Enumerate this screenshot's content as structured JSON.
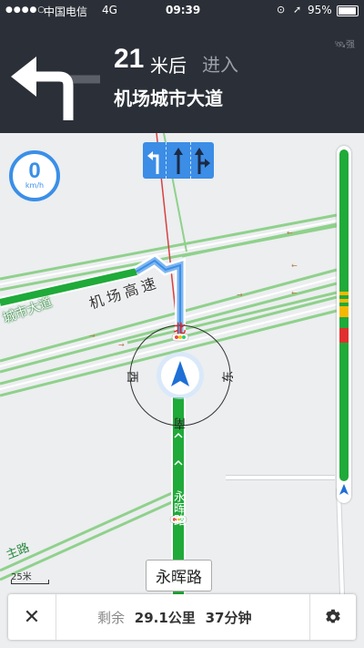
{
  "status_bar": {
    "signal_dots": "●●●●○",
    "carrier": "中国电信",
    "network": "4G",
    "time": "09:39",
    "battery": "95%"
  },
  "navigation": {
    "distance": "21",
    "distance_unit": "米后",
    "action": "进入",
    "road_name": "机场城市大道",
    "signal_strength": "强"
  },
  "speed": {
    "value": "0",
    "unit": "km/h"
  },
  "compass": {
    "north": "北",
    "east": "东",
    "south": "南",
    "west": "西"
  },
  "map_labels": {
    "road_left": "城市大道",
    "road_airport": "机场高速",
    "road_current_vertical": "永晖路",
    "road_bottom_left": "主路"
  },
  "scale": {
    "label": "25米"
  },
  "current_road": "永晖路",
  "trip": {
    "remaining_label": "剩余",
    "distance": "29.1公里",
    "time": "37分钟"
  },
  "colors": {
    "accent": "#3a8fe8",
    "route_green": "#1faa39",
    "nav_bg": "#2b2f37"
  }
}
